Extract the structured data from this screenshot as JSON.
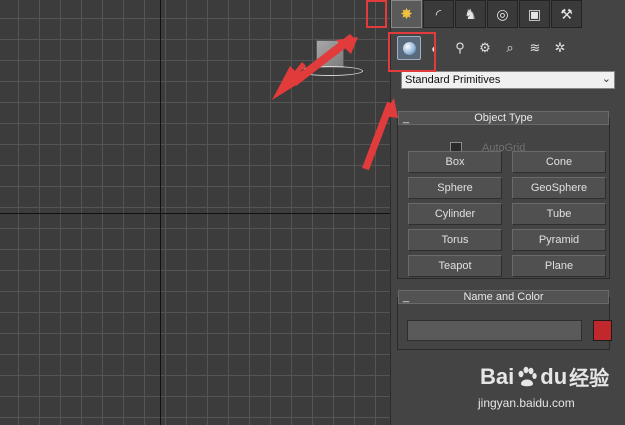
{
  "tabs": [
    {
      "name": "create",
      "icon": "create-sun-icon",
      "glyph": "✸"
    },
    {
      "name": "modify",
      "icon": "modify-curve-icon",
      "glyph": "◜"
    },
    {
      "name": "hierarchy",
      "icon": "hierarchy-icon",
      "glyph": "♞"
    },
    {
      "name": "motion",
      "icon": "motion-icon",
      "glyph": "◎"
    },
    {
      "name": "display",
      "icon": "display-icon",
      "glyph": "▣"
    },
    {
      "name": "utilities",
      "icon": "hammer-icon",
      "glyph": "⚒"
    }
  ],
  "subcategories": [
    {
      "name": "geometry",
      "icon": "sphere-icon",
      "glyph": ""
    },
    {
      "name": "shapes",
      "icon": "shapes-icon",
      "glyph": "◐"
    },
    {
      "name": "lights",
      "icon": "light-icon",
      "glyph": "⚲"
    },
    {
      "name": "cameras",
      "icon": "camera-icon",
      "glyph": "⚙"
    },
    {
      "name": "helpers",
      "icon": "helper-icon",
      "glyph": "⌕"
    },
    {
      "name": "spacewarps",
      "icon": "wave-icon",
      "glyph": "≋"
    },
    {
      "name": "systems",
      "icon": "systems-gear-icon",
      "glyph": "✲"
    }
  ],
  "dropdown": {
    "value": "Standard Primitives"
  },
  "object_type": {
    "title": "Object Type",
    "collapse": "_",
    "autogrid_label": "AutoGrid",
    "buttons": [
      "Box",
      "Cone",
      "Sphere",
      "GeoSphere",
      "Cylinder",
      "Tube",
      "Torus",
      "Pyramid",
      "Teapot",
      "Plane"
    ]
  },
  "name_color": {
    "title": "Name and Color",
    "collapse": "_",
    "name_value": "",
    "color": "#c0282c"
  },
  "viewport": {
    "grid_color": "#545454",
    "background": "#3c3c3c",
    "axis_color": "#111111"
  },
  "annotation_color": "#e23b3b",
  "watermark": {
    "brand_latin": "Bai",
    "brand_du": "du",
    "brand_cn": "经验",
    "url": "jingyan.baidu.com"
  }
}
